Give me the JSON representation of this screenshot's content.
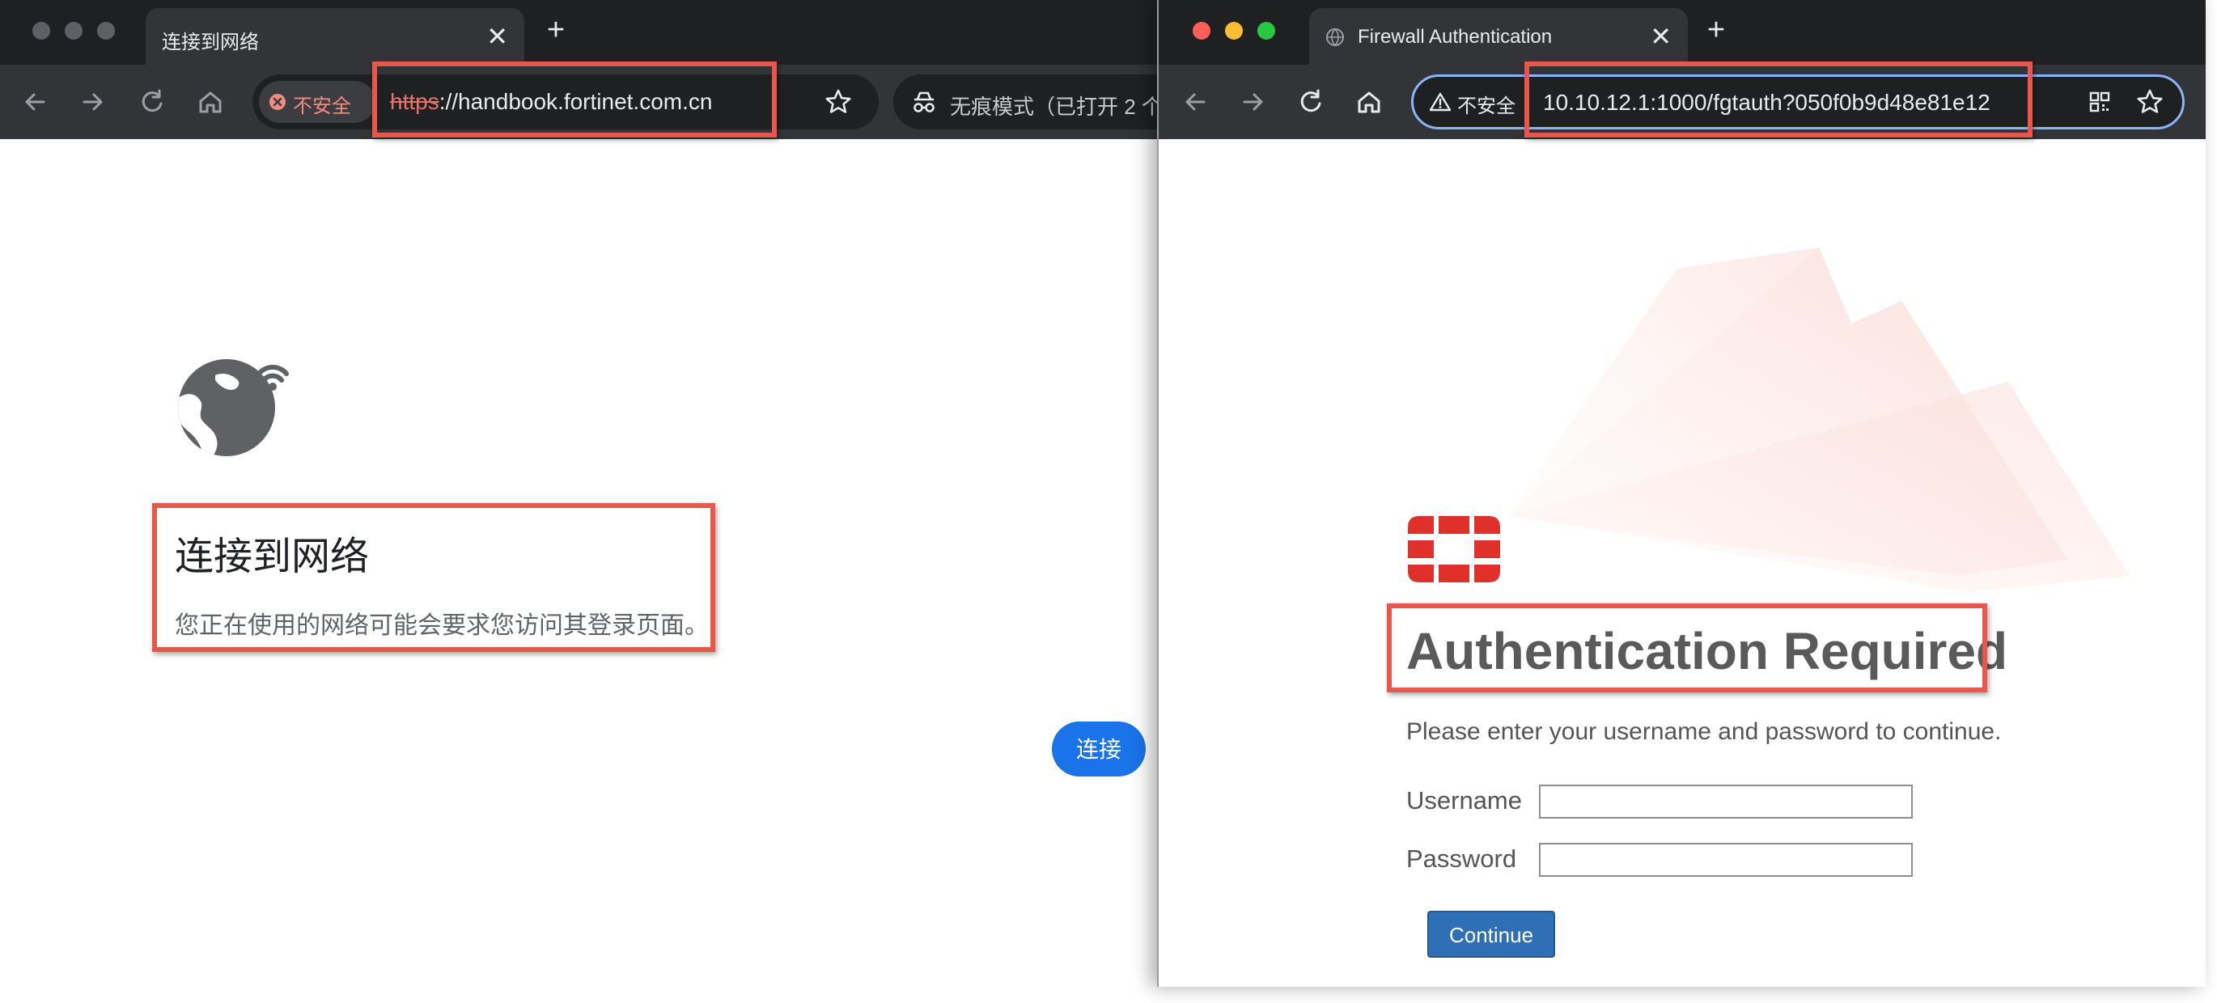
{
  "left_window": {
    "tab": {
      "title": "连接到网络",
      "close": "✕",
      "new_tab": "+"
    },
    "security_chip": {
      "label": "不安全"
    },
    "address": {
      "scheme": "https",
      "rest": "://handbook.fortinet.com.cn"
    },
    "incognito": {
      "label": "无痕模式（已打开 2 个"
    },
    "page": {
      "title": "连接到网络",
      "message": "您正在使用的网络可能会要求您访问其登录页面。",
      "connect_button": "连接"
    }
  },
  "right_window": {
    "tab": {
      "title": "Firewall Authentication",
      "close": "✕",
      "new_tab": "+"
    },
    "security_chip": {
      "label": "不安全"
    },
    "address": {
      "url": "10.10.12.1:1000/fgtauth?050f0b9d48e81e12"
    },
    "page": {
      "heading": "Authentication Required",
      "instruction": "Please enter your username and password to continue.",
      "username_label": "Username",
      "password_label": "Password",
      "username_value": "",
      "password_value": "",
      "continue_button": "Continue"
    }
  },
  "colors": {
    "highlight": "#e9574c",
    "fortinet_red": "#e0302a",
    "link_blue": "#1a73e8",
    "continue_blue": "#2f6fb5"
  },
  "icons": [
    "back-arrow-icon",
    "forward-arrow-icon",
    "reload-icon",
    "home-icon",
    "not-secure-icon",
    "warning-icon",
    "star-icon",
    "incognito-icon",
    "qr-code-icon",
    "globe-icon",
    "close-icon",
    "plus-icon",
    "fortinet-logo"
  ]
}
